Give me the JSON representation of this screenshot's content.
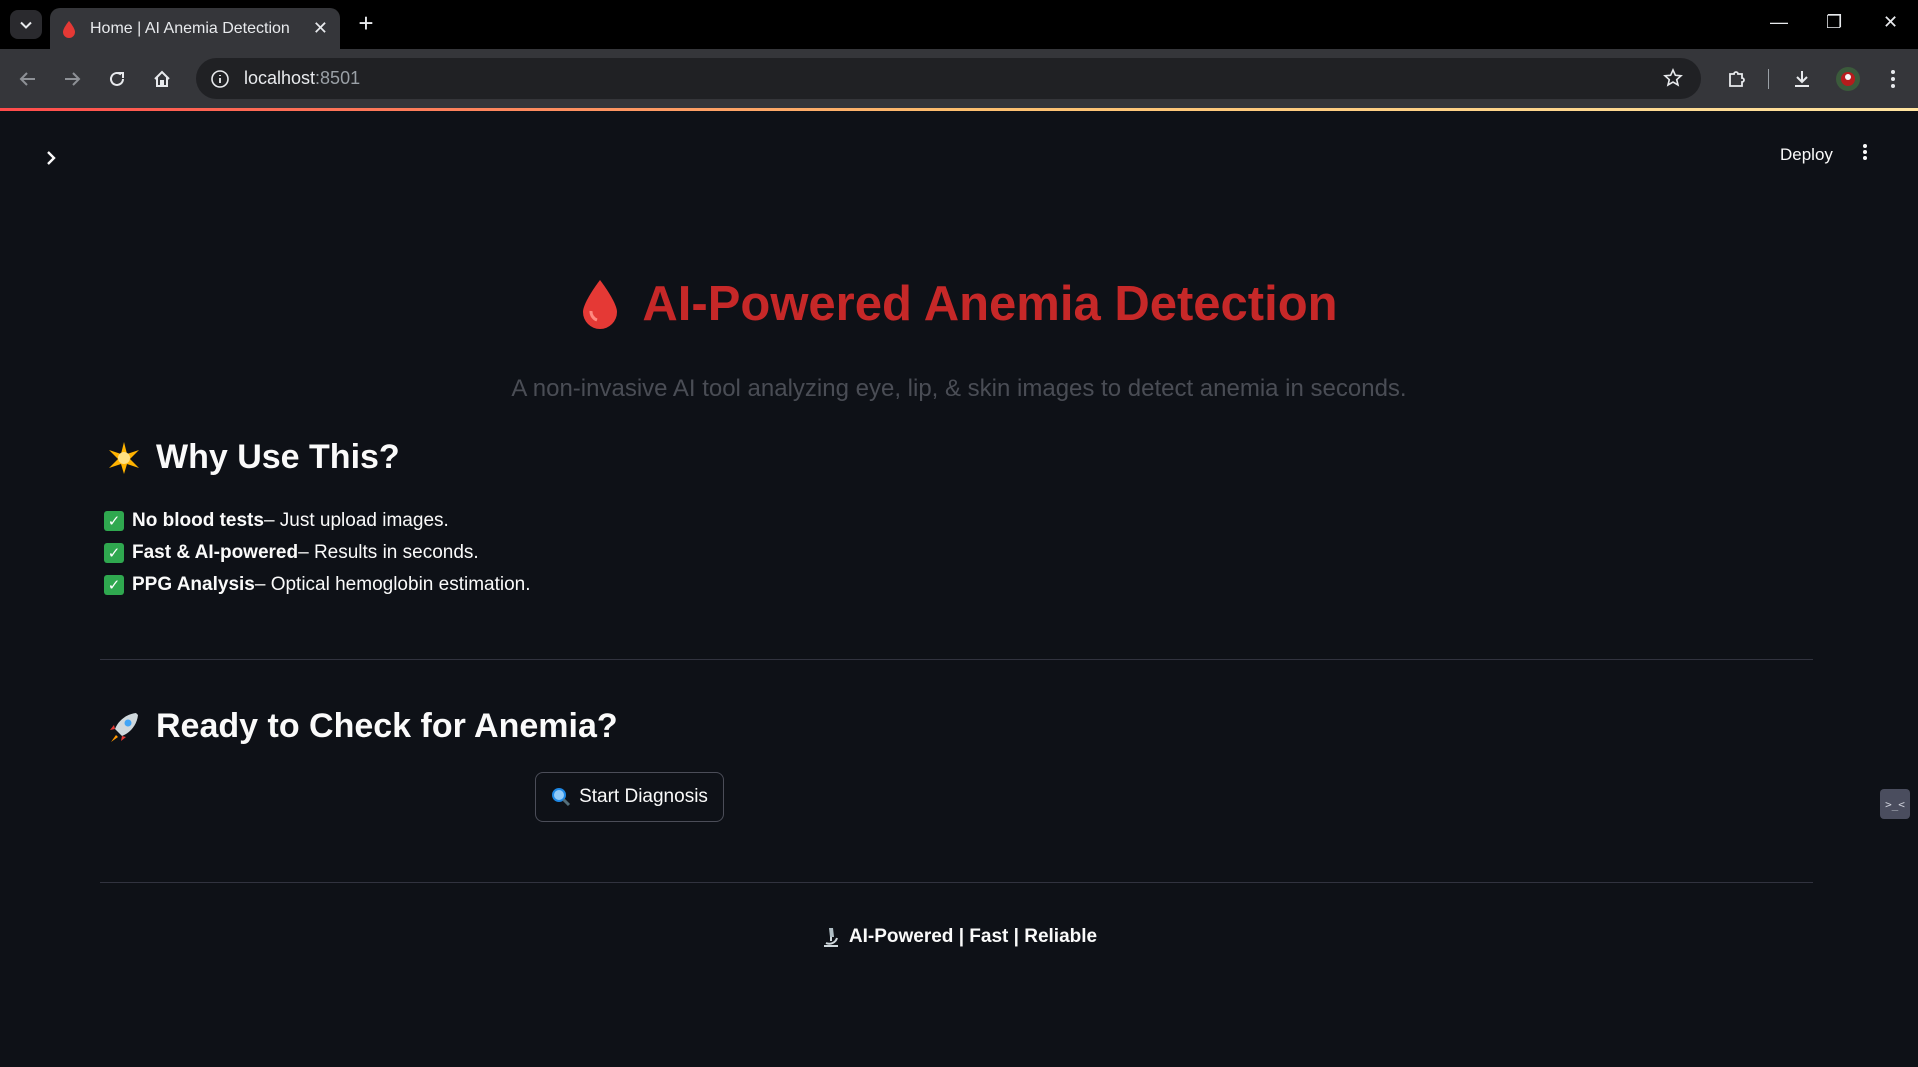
{
  "browser": {
    "tab_title": "Home | AI Anemia Detection",
    "url_host": "localhost",
    "url_port": ":8501",
    "accent_gradient": [
      "#ff4b4b",
      "#fdbf6f",
      "#ffe4a0"
    ]
  },
  "app": {
    "deploy_label": "Deploy",
    "title": "AI-Powered Anemia Detection",
    "title_color": "#c62828",
    "subtitle": "A non-invasive AI tool analyzing eye, lip, & skin images to detect anemia in seconds.",
    "why_heading": "Why Use This?",
    "benefits": [
      {
        "bold": "No blood tests",
        "rest": " – Just upload images."
      },
      {
        "bold": "Fast & AI-powered",
        "rest": " – Results in seconds."
      },
      {
        "bold": "PPG Analysis",
        "rest": " – Optical hemoglobin estimation."
      }
    ],
    "ready_heading": "Ready to Check for Anemia?",
    "start_button": "Start Diagnosis",
    "footer": "AI-Powered | Fast | Reliable"
  },
  "icons": {
    "title_icon": "blood-drop-icon",
    "why_icon": "star-icon",
    "ready_icon": "rocket-icon",
    "button_icon": "magnifier-icon",
    "footer_icon": "microscope-icon"
  }
}
